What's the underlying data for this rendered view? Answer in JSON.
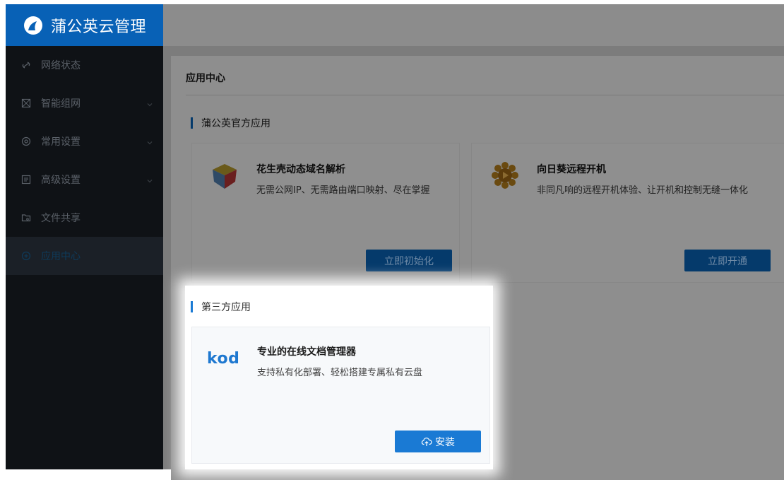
{
  "app": {
    "title": "蒲公英云管理"
  },
  "sidebar": {
    "items": [
      {
        "label": "网络状态",
        "icon": "network-status-icon",
        "has_chevron": false
      },
      {
        "label": "智能组网",
        "icon": "smart-network-icon",
        "has_chevron": true
      },
      {
        "label": "常用设置",
        "icon": "settings-icon",
        "has_chevron": true
      },
      {
        "label": "高级设置",
        "icon": "advanced-settings-icon",
        "has_chevron": true
      },
      {
        "label": "文件共享",
        "icon": "folder-share-icon",
        "has_chevron": false
      },
      {
        "label": "应用中心",
        "icon": "app-center-icon",
        "has_chevron": false,
        "active": true
      }
    ]
  },
  "main": {
    "title": "应用中心",
    "official": {
      "heading": "蒲公英官方应用",
      "apps": [
        {
          "name": "花生壳动态域名解析",
          "desc": "无需公网IP、无需路由端口映射、尽在掌握",
          "button": "立即初始化",
          "icon": "peanut-shell-cube-icon"
        },
        {
          "name": "向日葵远程开机",
          "desc": "非同凡响的远程开机体验、让开机和控制无缝一体化",
          "button": "立即开通",
          "icon": "sunflower-icon"
        }
      ]
    },
    "third_party": {
      "heading": "第三方应用",
      "apps": [
        {
          "logo_text": "kod",
          "name": "专业的在线文档管理器",
          "desc": "支持私有化部署、轻松搭建专属私有云盘",
          "button": "安装",
          "icon": "cloud-upload-icon"
        }
      ]
    }
  },
  "colors": {
    "brand_blue": "#0861b6",
    "accent": "#1a7ad4",
    "sidebar_bg": "#0f1216",
    "kod_logo": "#1e78d0"
  }
}
